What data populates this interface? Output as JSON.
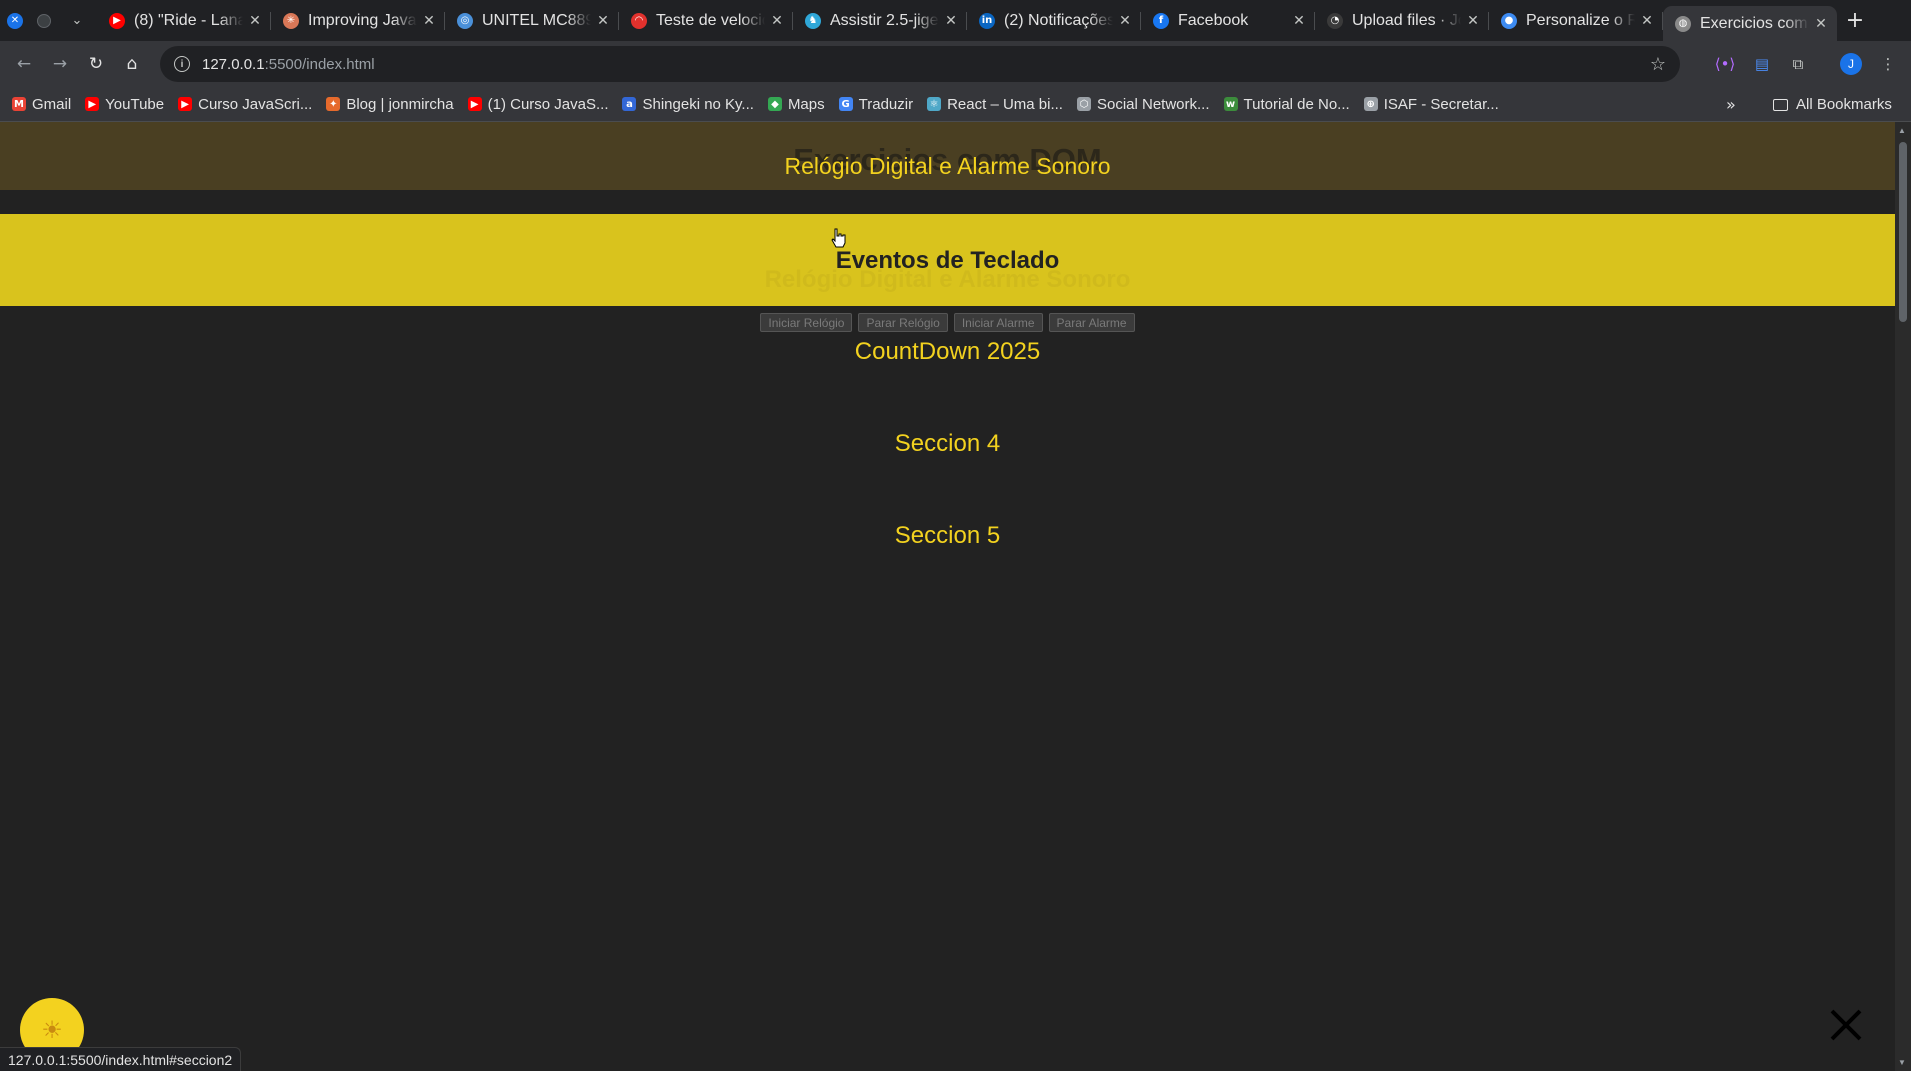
{
  "browser": {
    "tabs": [
      {
        "title": "(8) \"Ride - Lana",
        "icon": "youtube-icon",
        "color": "#ff0000",
        "glyph": "▶"
      },
      {
        "title": "Improving Java",
        "icon": "claude-icon",
        "color": "#d97757",
        "glyph": "✳"
      },
      {
        "title": "UNITEL MC889",
        "icon": "globe-icon",
        "color": "#4a90d9",
        "glyph": "◎"
      },
      {
        "title": "Teste de velocid",
        "icon": "speedtest-icon",
        "color": "#e2312d",
        "glyph": "◠"
      },
      {
        "title": "Assistir 2.5-jige",
        "icon": "anime-icon",
        "color": "#2fa7d8",
        "glyph": "♞"
      },
      {
        "title": "(2) Notificações",
        "icon": "linkedin-icon",
        "color": "#0a66c2",
        "glyph": "in"
      },
      {
        "title": "Facebook",
        "icon": "facebook-icon",
        "color": "#1877f2",
        "glyph": "f"
      },
      {
        "title": "Upload files · Jo",
        "icon": "github-icon",
        "color": "#3a3a3a",
        "glyph": "◔"
      },
      {
        "title": "Personalize o R",
        "icon": "figma-icon",
        "color": "#3d8bf2",
        "glyph": "●"
      },
      {
        "title": "Exercicios com",
        "icon": "page-icon",
        "color": "#8a8a8a",
        "glyph": "◍"
      }
    ],
    "url": {
      "host": "127.0.0.1",
      "path": ":5500/index.html"
    },
    "profile_initial": "J",
    "bookmarks": [
      {
        "label": "Gmail",
        "icon": "gmail-icon",
        "color": "#ea4335",
        "glyph": "M"
      },
      {
        "label": "YouTube",
        "icon": "youtube-icon",
        "color": "#ff0000",
        "glyph": "▶"
      },
      {
        "label": "Curso JavaScri...",
        "icon": "youtube-icon",
        "color": "#ff0000",
        "glyph": "▶"
      },
      {
        "label": "Blog | jonmircha",
        "icon": "blog-icon",
        "color": "#e66a2c",
        "glyph": "✦"
      },
      {
        "label": "(1) Curso JavaS...",
        "icon": "youtube-icon",
        "color": "#ff0000",
        "glyph": "▶"
      },
      {
        "label": "Shingeki no Ky...",
        "icon": "anime-icon",
        "color": "#3367d6",
        "glyph": "a"
      },
      {
        "label": "Maps",
        "icon": "maps-icon",
        "color": "#34a853",
        "glyph": "◆"
      },
      {
        "label": "Traduzir",
        "icon": "translate-icon",
        "color": "#4285f4",
        "glyph": "G"
      },
      {
        "label": "React – Uma bi...",
        "icon": "react-icon",
        "color": "#4fa8c8",
        "glyph": "⚛"
      },
      {
        "label": "Social Network...",
        "icon": "network-icon",
        "color": "#9aa0a6",
        "glyph": "⬡"
      },
      {
        "label": "Tutorial de No...",
        "icon": "node-icon",
        "color": "#3c8c3c",
        "glyph": "w"
      },
      {
        "label": "ISAF - Secretar...",
        "icon": "globe-icon",
        "color": "#9aa0a6",
        "glyph": "⊕"
      }
    ],
    "all_bookmarks_label": "All Bookmarks",
    "status_url": "127.0.0.1:5500/index.html#seccion2"
  },
  "page": {
    "site_title": "Exercicios com DOM",
    "menu": [
      "Relógio Digital e Alarme Sonoro",
      "Eventos de Teclado",
      "CountDown 2025",
      "Seccion 4",
      "Seccion 5"
    ],
    "ghost_section_title": "Relógio Digital e Alarme Sonoro",
    "clock_buttons": [
      "Iniciar Relógio",
      "Parar Relógio",
      "Iniciar Alarme",
      "Parar Alarme"
    ]
  },
  "colors": {
    "accent": "#f3d21f",
    "highlight": "#d9c31d",
    "page_bg": "#222222",
    "header_bg": "#4a3f22"
  }
}
